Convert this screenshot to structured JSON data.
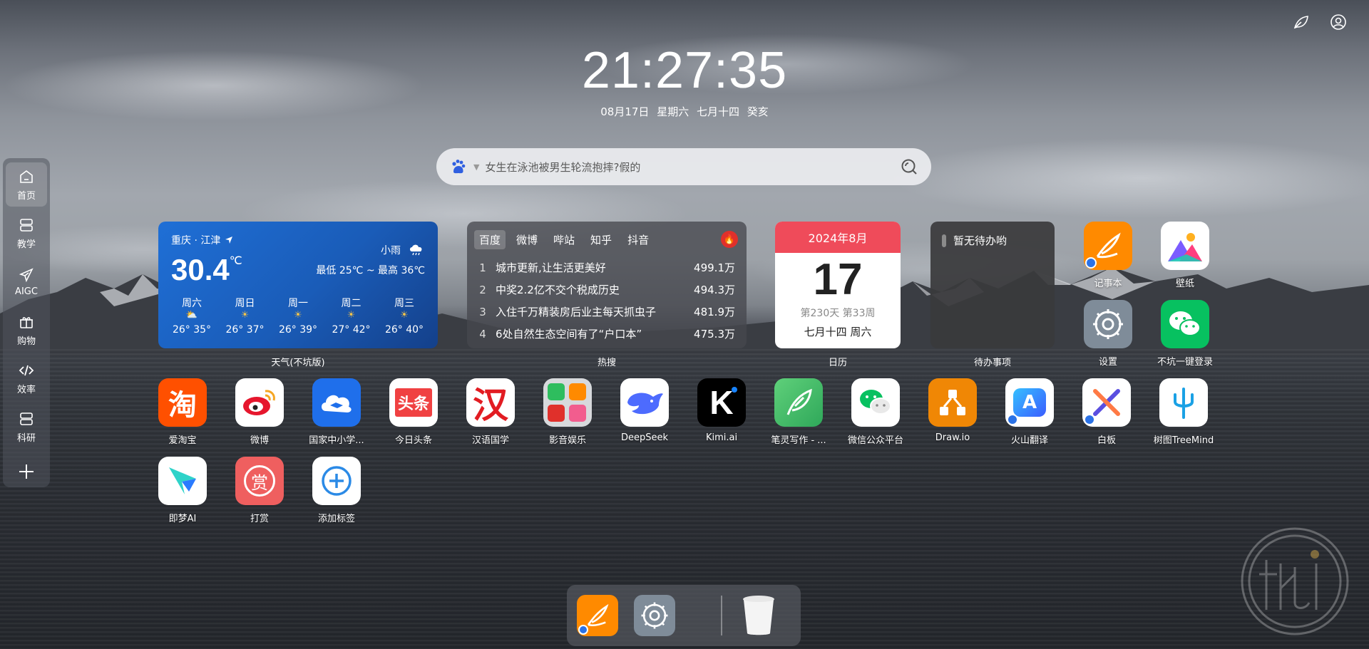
{
  "clock": {
    "time": "21:27:35",
    "date_line": "08月17日 星期六 七月十四 癸亥"
  },
  "search": {
    "placeholder": "女生在泳池被男生轮流抱摔?假的"
  },
  "sidebar": {
    "items": [
      {
        "label": "首页",
        "icon": "home-icon",
        "active": true
      },
      {
        "label": "教学",
        "icon": "server-icon"
      },
      {
        "label": "AIGC",
        "icon": "plane-icon"
      },
      {
        "label": "购物",
        "icon": "gift-icon"
      },
      {
        "label": "效率",
        "icon": "code-icon"
      },
      {
        "label": "科研",
        "icon": "server-icon"
      }
    ],
    "add_icon": "plus-icon"
  },
  "weather": {
    "location": "重庆 · 江津",
    "temp": "30.4",
    "unit": "℃",
    "condition": "小雨",
    "range": "最低 25℃ ~ 最高 36℃",
    "forecast": [
      {
        "day": "周六",
        "range": "26° 35°"
      },
      {
        "day": "周日",
        "range": "26° 37°"
      },
      {
        "day": "周一",
        "range": "26° 39°"
      },
      {
        "day": "周二",
        "range": "27° 42°"
      },
      {
        "day": "周三",
        "range": "26° 40°"
      }
    ],
    "caption": "天气(不坑版)"
  },
  "hot": {
    "tabs": [
      "百度",
      "微博",
      "哔站",
      "知乎",
      "抖音"
    ],
    "items": [
      {
        "rank": "1",
        "title": "城市更新,让生活更美好",
        "heat": "499.1万"
      },
      {
        "rank": "2",
        "title": "中奖2.2亿不交个税成历史",
        "heat": "494.3万"
      },
      {
        "rank": "3",
        "title": "入住千万精装房后业主每天抓虫子",
        "heat": "481.9万"
      },
      {
        "rank": "4",
        "title": "6处自然生态空间有了“户口本”",
        "heat": "475.3万"
      }
    ],
    "caption": "热搜"
  },
  "calendar": {
    "month": "2024年8月",
    "day": "17",
    "sub": "第230天 第33周",
    "lunar": "七月十四 周六",
    "caption": "日历"
  },
  "todo": {
    "empty_text": "暂无待办哟",
    "caption": "待办事项"
  },
  "apps": {
    "notepad": "记事本",
    "wallpaper": "壁纸",
    "settings": "设置",
    "wechat_login": "不坑一键登录",
    "taobao": "爱淘宝",
    "weibo": "微博",
    "zxx": "国家中小学...",
    "toutiao": "今日头条",
    "hanyu": "汉语国学",
    "yingyin": "影音娱乐",
    "deepseek": "DeepSeek",
    "kimi": "Kimi.ai",
    "biling": "笔灵写作 - ...",
    "wxmp": "微信公众平台",
    "drawio": "Draw.io",
    "huoshan": "火山翻译",
    "whiteboard": "白板",
    "treemind": "树图TreeMind",
    "jimeng": "即梦AI",
    "reward": "打赏",
    "add": "添加标签"
  },
  "icon_text": {
    "taobao": "淘",
    "toutiao": "头条",
    "hanyu": "汉",
    "kimi": "K",
    "drawio_letter": "",
    "reward": "赏",
    "huoshan": "A"
  },
  "colors": {
    "weather_bg": "#1f6fd6",
    "calendar_head": "#ef4b5a",
    "hot_fire": "#e0302b",
    "taobao": "#ff5000",
    "notepad": "#ff8a00",
    "wechat": "#07c160"
  }
}
